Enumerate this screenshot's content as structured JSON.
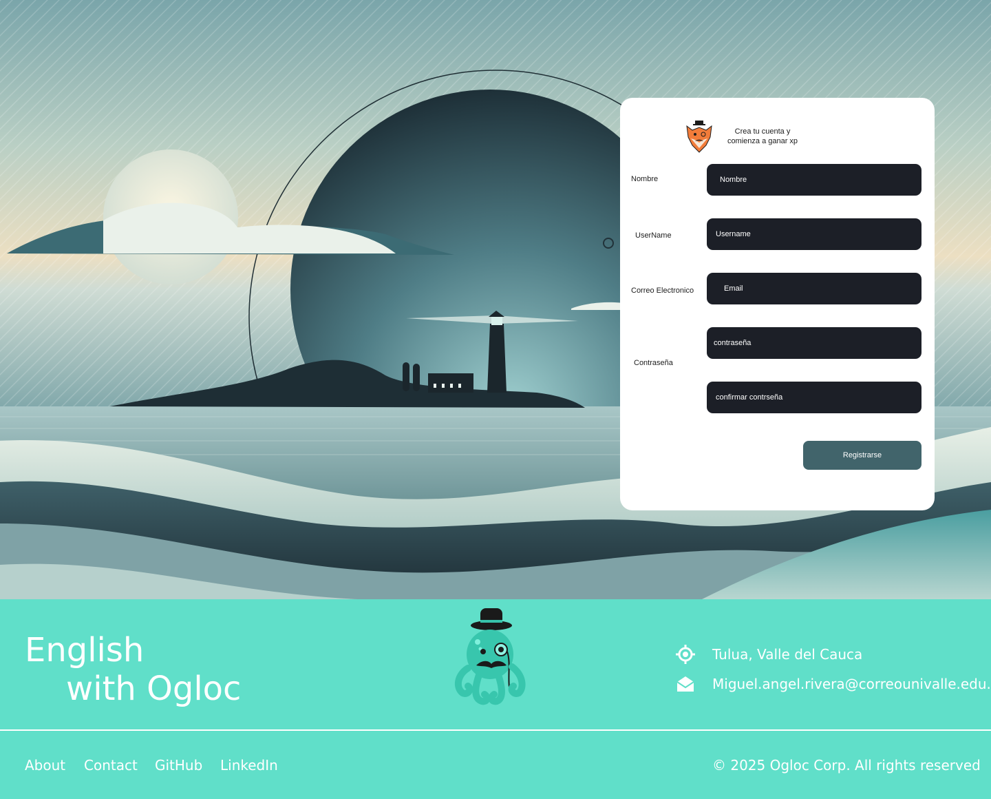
{
  "form": {
    "tagline": "Crea tu cuenta y comienza a ganar xp",
    "fields": [
      {
        "label": "Nombre",
        "placeholder": "Nombre"
      },
      {
        "label": "UserName",
        "placeholder": "Username"
      },
      {
        "label": "Correo Electronico",
        "placeholder": "Email"
      },
      {
        "label": "Contraseña",
        "placeholder": "contraseña"
      },
      {
        "label": "",
        "placeholder": "confirmar contrseña"
      }
    ],
    "submit_label": "Registrarse"
  },
  "footer": {
    "brand_line1": "English",
    "brand_line2": "with Ogloc",
    "location": "Tulua, Valle del Cauca",
    "email": "Miguel.angel.rivera@correounivalle.edu.co",
    "nav": [
      "About",
      "Contact",
      "GitHub",
      "LinkedIn"
    ],
    "copyright": "© 2025 Ogloc Corp. All rights reserved"
  },
  "icons": {
    "location": "location-target-icon",
    "email": "mail-icon",
    "fox": "fox-logo",
    "octopus": "octopus-mascot"
  },
  "colors": {
    "footer_bg": "#60dfc9",
    "field_bg": "#1c1f27",
    "button_bg": "#41646b",
    "card_bg": "#ffffff"
  }
}
